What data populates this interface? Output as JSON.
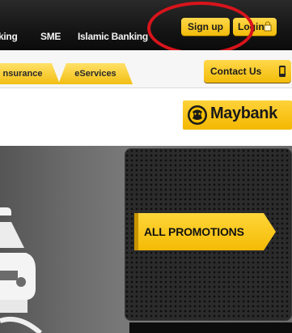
{
  "header": {
    "nav": [
      "king",
      "SME",
      "Islamic Banking"
    ],
    "signup_label": "Sign up",
    "login_label": "Login"
  },
  "tabs": {
    "items": [
      "nsurance",
      "eServices"
    ],
    "contact_label": "Contact Us"
  },
  "brand": {
    "logo_text": "Maybank"
  },
  "promo": {
    "button_label": "ALL PROMOTIONS"
  },
  "colors": {
    "brand_yellow": "#f5c000",
    "highlight_ring": "#d8141b",
    "topbar": "#151515"
  }
}
